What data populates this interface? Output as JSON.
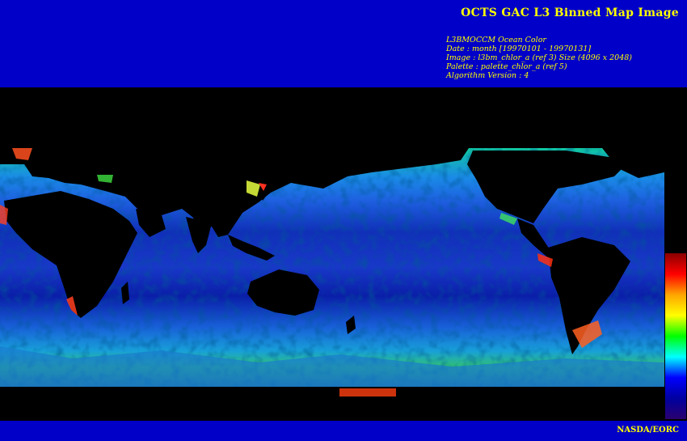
{
  "title": "OCTS GAC L3 Binned Map Image",
  "metadata": [
    "L3BMOCCM Ocean Color",
    "Date : month [19970101 - 19970131]",
    "Image : l3bm_chlor_a (ref 3) Size (4096 x 2048)",
    "Palette : palette_chlor_a (ref 5)",
    "Algorithm Version : 4"
  ],
  "credit": "NASDA/EORC",
  "colors": {
    "header_bg": "#0000c8",
    "text": "#ffff00",
    "land": "#000000"
  },
  "colorbar_palette": [
    "#8b0000",
    "#ff0000",
    "#ffa500",
    "#ffff00",
    "#00ff00",
    "#00ffff",
    "#0000ff",
    "#0000a0",
    "#2a006e"
  ]
}
